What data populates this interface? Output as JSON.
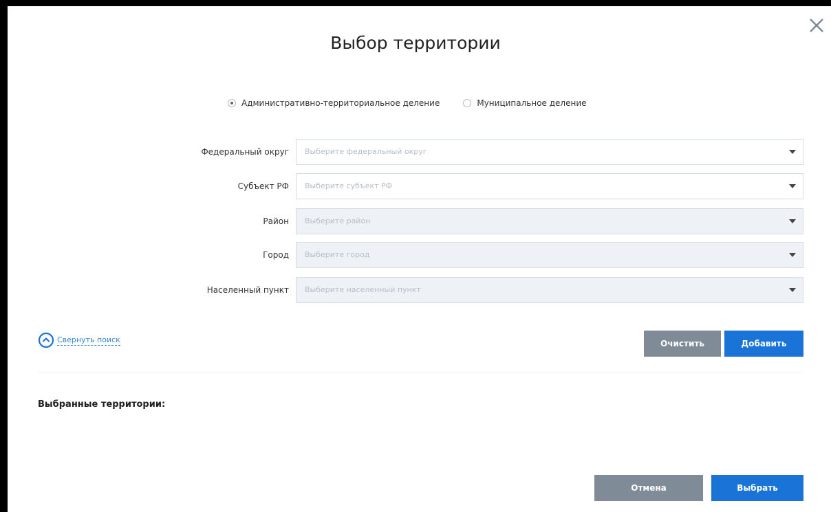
{
  "dialog": {
    "title": "Выбор территории",
    "close_icon": "close-icon"
  },
  "division": {
    "options": [
      {
        "label": "Административно-территориальное деление",
        "checked": true
      },
      {
        "label": "Муниципальное деление",
        "checked": false
      }
    ]
  },
  "fields": [
    {
      "label": "Федеральный округ",
      "placeholder": "Выберите федеральный округ",
      "enabled": true
    },
    {
      "label": "Субъект РФ",
      "placeholder": "Выберите субъект РФ",
      "enabled": true
    },
    {
      "label": "Район",
      "placeholder": "Выберите район",
      "enabled": false
    },
    {
      "label": "Город",
      "placeholder": "Выберите город",
      "enabled": false
    },
    {
      "label": "Населенный пункт",
      "placeholder": "Выберите населенный пункт",
      "enabled": false
    }
  ],
  "search": {
    "collapse_label": "Свернуть поиск",
    "clear_label": "Очистить",
    "add_label": "Добавить"
  },
  "selected": {
    "heading": "Выбранные территории:"
  },
  "footer": {
    "cancel_label": "Отмена",
    "select_label": "Выбрать"
  },
  "colors": {
    "primary": "#1a73d6",
    "secondary": "#7f8c98",
    "link": "#3a86c8"
  }
}
